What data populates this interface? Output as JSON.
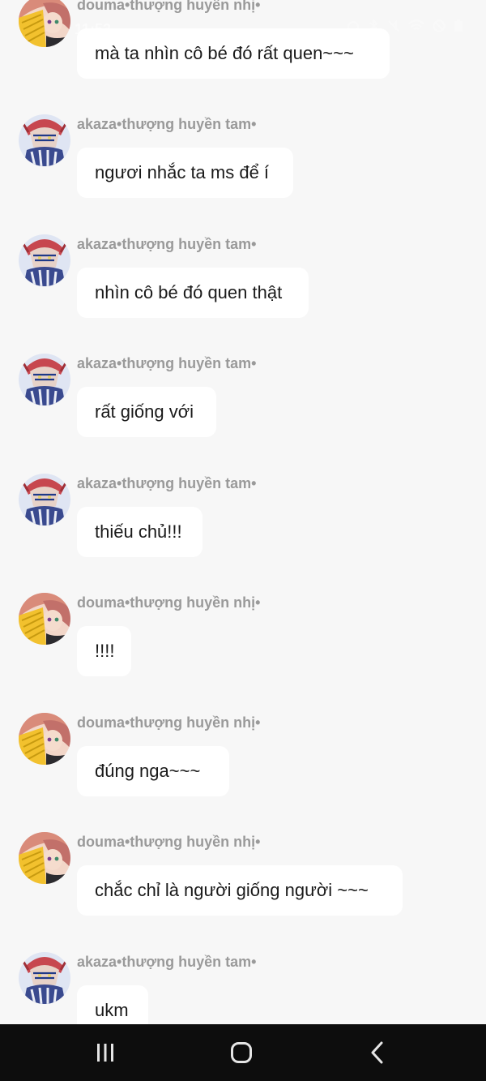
{
  "status_bar": {
    "time": "11:53",
    "icons": [
      "alarm-icon",
      "bluetooth-icon",
      "mute-icon",
      "wifi-icon",
      "dnd-icon",
      "battery-icon"
    ]
  },
  "messages": [
    {
      "sender": "douma•thượng huyền nhị•",
      "text": "mà ta nhìn cô bé đó rất quen~~~",
      "avatar": "douma"
    },
    {
      "sender": "akaza•thượng huyền tam•",
      "text": "ngươi nhắc ta ms để í",
      "avatar": "akaza"
    },
    {
      "sender": "akaza•thượng huyền tam•",
      "text": "nhìn cô bé đó quen thật",
      "avatar": "akaza"
    },
    {
      "sender": "akaza•thượng huyền tam•",
      "text": "rất giống với",
      "avatar": "akaza"
    },
    {
      "sender": "akaza•thượng huyền tam•",
      "text": "thiếu chủ!!!",
      "avatar": "akaza"
    },
    {
      "sender": "douma•thượng huyền nhị•",
      "text": "!!!!",
      "avatar": "douma"
    },
    {
      "sender": "douma•thượng huyền nhị•",
      "text": "đúng nga~~~",
      "avatar": "douma"
    },
    {
      "sender": "douma•thượng huyền nhị•",
      "text": "chắc chỉ là người giống người ~~~",
      "avatar": "douma"
    },
    {
      "sender": "akaza•thượng huyền tam•",
      "text": "ukm",
      "avatar": "akaza"
    }
  ],
  "nav_bar": {
    "buttons": [
      "recents-button",
      "home-button",
      "back-button"
    ]
  },
  "colors": {
    "background": "#f7f7f7",
    "bubble": "#ffffff",
    "sender_text": "#9a9a9a",
    "message_text": "#1a1a1a",
    "nav_background": "#0d0d0d"
  }
}
